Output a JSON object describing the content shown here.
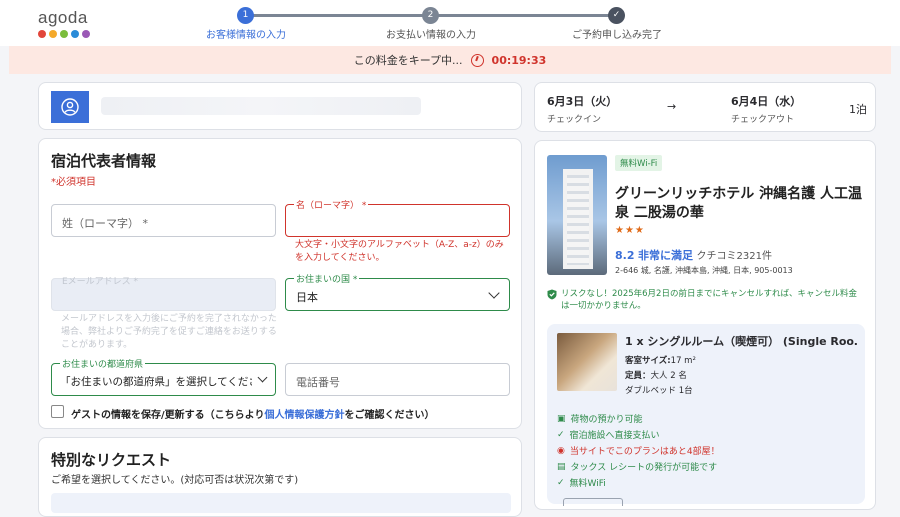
{
  "header": {
    "logo": "agoda",
    "logo_dots": [
      "#e2463b",
      "#f4a92a",
      "#7bbd3c",
      "#2a8bd8",
      "#9b59b6"
    ],
    "steps": [
      {
        "number": "1",
        "label": "お客様情報の入力",
        "state": "active"
      },
      {
        "number": "2",
        "label": "お支払い情報の入力",
        "state": "pending"
      },
      {
        "number": "✓",
        "label": "ご予約申し込み完了",
        "state": "pending"
      }
    ]
  },
  "timer": {
    "text": "この料金をキープ中...",
    "value": "00:19:33"
  },
  "guest_form": {
    "title": "宿泊代表者情報",
    "required_note": "*必須項目",
    "last_name_placeholder": "姓（ローマ字） *",
    "first_name_label": "名（ローマ字） *",
    "first_name_error": "大文字・小文字のアルファベット（A-Z、a-z）のみを入力してください。",
    "email_label": "Eメールアドレス *",
    "email_help": "メールアドレスを入力後にご予約を完了されなかった場合、弊社よりご予約完了を促すご連絡をお送りすることがあります。",
    "country_label": "お住まいの国 *",
    "country_value": "日本",
    "prefecture_label": "お住まいの都道府県",
    "prefecture_value": "「お住まいの都道府県」を選択してください",
    "phone_placeholder": "電話番号",
    "save_text_prefix": "ゲストの情報を保存/更新する（こちらより",
    "save_link": "個人情報保護方針",
    "save_text_suffix": "をご確認ください）"
  },
  "special_request": {
    "title": "特別なリクエスト",
    "subtitle": "ご希望を選択してください。(対応可否は状況次第です)"
  },
  "stay": {
    "checkin_date": "6月3日（火）",
    "checkin_label": "チェックイン",
    "arrow": "→",
    "checkout_date": "6月4日（水）",
    "checkout_label": "チェックアウト",
    "nights": "1泊"
  },
  "hotel": {
    "badge": "無料Wi-Fi",
    "name": "グリーンリッチホテル 沖縄名護 人工温泉 二股湯の華",
    "stars": "★★★",
    "rating_score": "8.2",
    "rating_text": "非常に満足",
    "reviews": "クチコミ2321件",
    "address": "2-646 城, 名護, 沖縄本島, 沖縄, 日本, 905-0013",
    "cancel_note": "リスクなし！2025年6月2日の前日までにキャンセルすれば、キャンセル料金は一切かかりません。"
  },
  "room": {
    "title": "1 x シングルルーム（喫煙可） (Single Roo…",
    "size_label": "客室サイズ:",
    "size_value": "17 m²",
    "capacity_label": "定員：",
    "capacity_value": "大人 2 名",
    "bed": "ダブルベッド 1台",
    "features": [
      {
        "icon": "luggage-icon",
        "text": "荷物の預かり可能",
        "color": "#2e8b4a"
      },
      {
        "icon": "check-icon",
        "text": "宿泊施設へ直接支払い",
        "color": "#2e8b4a"
      },
      {
        "icon": "alert-icon",
        "text": "当サイトでこのプランはあと4部屋！",
        "color": "#d0342c"
      },
      {
        "icon": "receipt-icon",
        "text": "タックス レシートの発行が可能です",
        "color": "#2e8b4a"
      },
      {
        "icon": "check-icon",
        "text": "無料WiFi",
        "color": "#2e8b4a"
      }
    ]
  },
  "colors": {
    "accent": "#3b6fd8",
    "error": "#d0342c",
    "success": "#2e8b4a",
    "timer_bg": "#fde8e2"
  }
}
